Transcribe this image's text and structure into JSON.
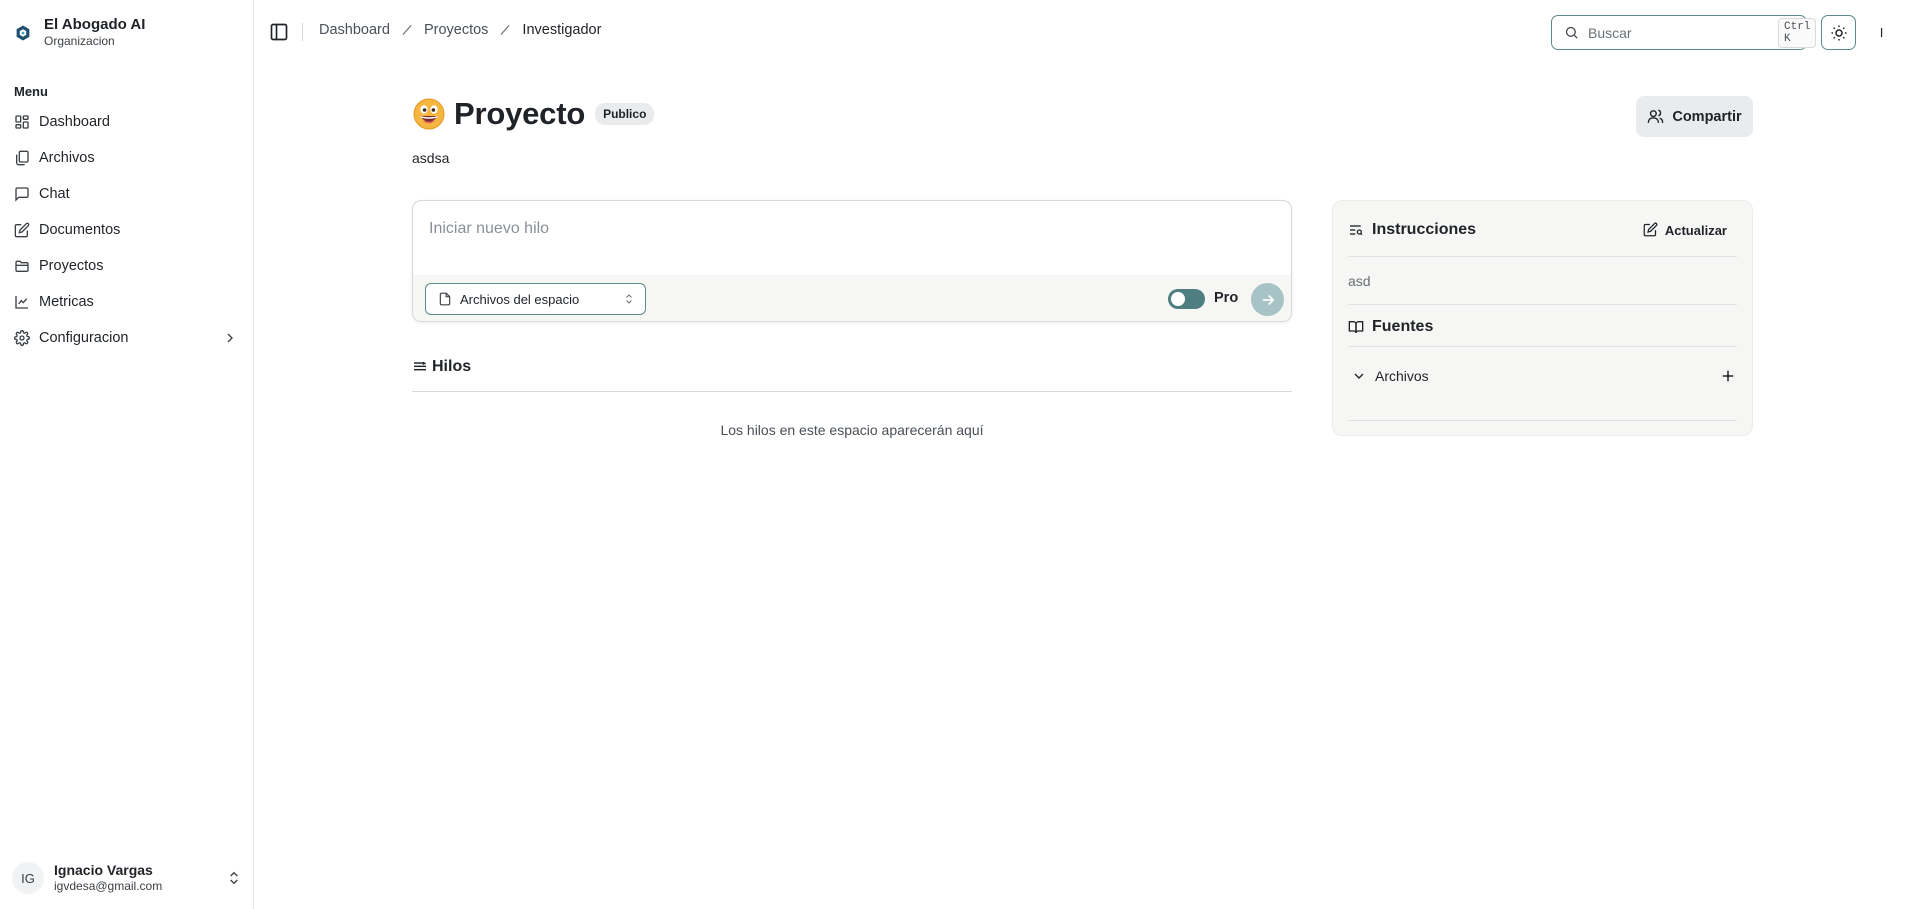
{
  "org": {
    "name": "El Abogado AI",
    "subtitle": "Organizacion"
  },
  "sidebar": {
    "menu_label": "Menu",
    "items": [
      {
        "label": "Dashboard",
        "icon": "dashboard-icon"
      },
      {
        "label": "Archivos",
        "icon": "files-icon"
      },
      {
        "label": "Chat",
        "icon": "chat-icon"
      },
      {
        "label": "Documentos",
        "icon": "document-icon"
      },
      {
        "label": "Proyectos",
        "icon": "folder-icon"
      },
      {
        "label": "Metricas",
        "icon": "chart-icon"
      },
      {
        "label": "Configuracion",
        "icon": "gear-icon"
      }
    ]
  },
  "user": {
    "initials": "IG",
    "name": "Ignacio Vargas",
    "email": "igvdesa@gmail.com"
  },
  "breadcrumb": {
    "items": [
      "Dashboard",
      "Proyectos"
    ],
    "current": "Investigador"
  },
  "search": {
    "placeholder": "Buscar",
    "shortcut": "Ctrl K"
  },
  "profile": {
    "initial": "I"
  },
  "project": {
    "title": "Proyecto",
    "badge": "Publico",
    "description": "asdsa",
    "share_label": "Compartir"
  },
  "composer": {
    "placeholder": "Iniciar nuevo hilo",
    "space_select": "Archivos del espacio",
    "pro_label": "Pro",
    "pro_enabled": true
  },
  "threads": {
    "title": "Hilos",
    "empty": "Los hilos en este espacio aparecerán aquí"
  },
  "panel": {
    "instructions_title": "Instrucciones",
    "update_label": "Actualizar",
    "instructions_text": "asd",
    "sources_title": "Fuentes",
    "files_label": "Archivos"
  },
  "colors": {
    "accent": "#4e7e80",
    "accent_border": "#5d8a8c",
    "send_button": "#a7c3c5",
    "badge_bg": "#e9ebec",
    "panel_bg": "#f6f6f5"
  }
}
